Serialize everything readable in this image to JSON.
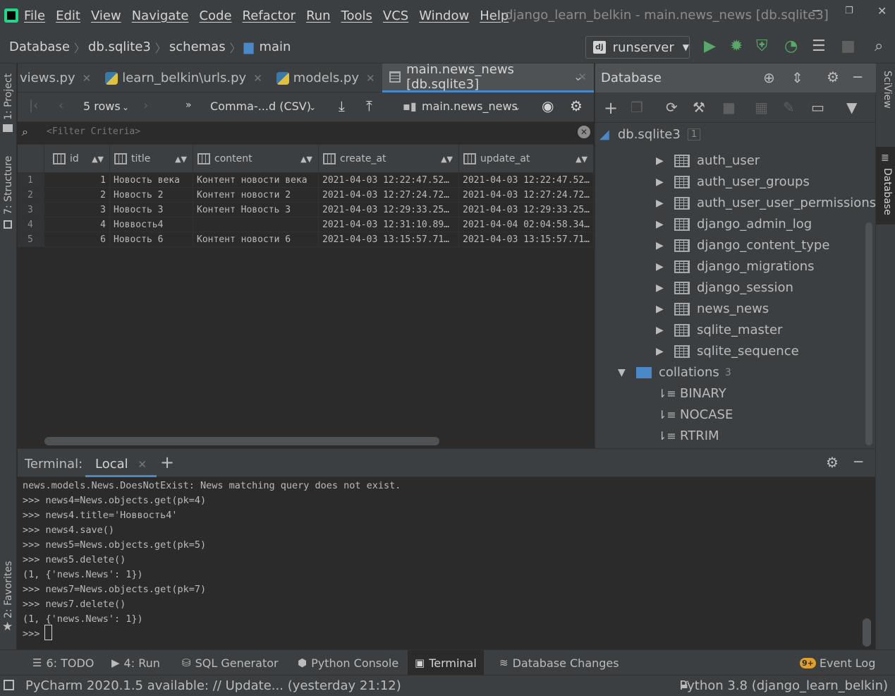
{
  "menu": {
    "items": [
      "File",
      "Edit",
      "View",
      "Navigate",
      "Code",
      "Refactor",
      "Run",
      "Tools",
      "VCS",
      "Window",
      "Help"
    ],
    "window_title": "django_learn_belkin - main.news_news [db.sqlite3]"
  },
  "navbar": {
    "breadcrumbs": [
      "Database",
      "db.sqlite3",
      "schemas",
      "main"
    ],
    "run_config": "runserver"
  },
  "left_strip": {
    "project": "1: Project",
    "structure": "7: Structure",
    "favorites": "2: Favorites"
  },
  "right_strip": {
    "sciview": "SciView",
    "database": "Database"
  },
  "tabs": [
    {
      "label": "views.py"
    },
    {
      "label": "learn_belkin\\urls.py"
    },
    {
      "label": "models.py"
    },
    {
      "label": "main.news_news [db.sqlite3]"
    }
  ],
  "grid_toolbar": {
    "rows": "5 rows",
    "extractor": "Comma-...d (CSV)",
    "table": "main.news_news"
  },
  "filter": {
    "placeholder": "<Filter Criteria>"
  },
  "grid": {
    "columns": [
      "id",
      "title",
      "content",
      "create_at",
      "update_at"
    ],
    "rows": [
      {
        "n": "1",
        "id": "1",
        "title": "Новость века",
        "content": "Контент новости века",
        "create_at": "2021-04-03 12:22:47.52…",
        "update_at": "2021-04-03 12:22:47.52…"
      },
      {
        "n": "2",
        "id": "2",
        "title": "Новость 2",
        "content": "Контент новости 2",
        "create_at": "2021-04-03 12:27:24.72…",
        "update_at": "2021-04-03 12:27:24.72…"
      },
      {
        "n": "3",
        "id": "3",
        "title": "Новость 3",
        "content": "Контент Новость 3",
        "create_at": "2021-04-03 12:29:33.25…",
        "update_at": "2021-04-03 12:29:33.25…"
      },
      {
        "n": "4",
        "id": "4",
        "title": "Нoввость4",
        "content": "",
        "create_at": "2021-04-03 12:31:10.89…",
        "update_at": "2021-04-04 02:04:58.34…"
      },
      {
        "n": "5",
        "id": "6",
        "title": "Новость 6",
        "content": "Контент новости 6",
        "create_at": "2021-04-03 13:15:57.71…",
        "update_at": "2021-04-03 13:15:57.71…"
      }
    ]
  },
  "db_panel": {
    "title": "Database",
    "root": "db.sqlite3",
    "root_count": "1",
    "tables": [
      "auth_user",
      "auth_user_groups",
      "auth_user_user_permissions",
      "django_admin_log",
      "django_content_type",
      "django_migrations",
      "django_session",
      "news_news",
      "sqlite_master",
      "sqlite_sequence"
    ],
    "collations_label": "collations",
    "collations_count": "3",
    "collations": [
      "BINARY",
      "NOCASE",
      "RTRIM"
    ]
  },
  "terminal": {
    "label": "Terminal:",
    "tab": "Local",
    "lines": [
      "news.models.News.DoesNotExist: News matching query does not exist.",
      ">>> news4=News.objects.get(pk=4)",
      ">>> news4.title='Нoввость4'",
      ">>> news4.save()",
      ">>> news5=News.objects.get(pk=5)",
      ">>> news5.delete()",
      "(1, {'news.News': 1})",
      ">>> news7=News.objects.get(pk=7)",
      ">>> news7.delete()",
      "(1, {'news.News': 1})",
      ">>> "
    ]
  },
  "bottom_tools": {
    "todo": "6: TODO",
    "run": "4: Run",
    "sql": "SQL Generator",
    "pyconsole": "Python Console",
    "terminal": "Terminal",
    "dbchanges": "Database Changes",
    "eventlog": "Event Log",
    "eventlog_badge": "9+"
  },
  "status": {
    "message": "PyCharm 2020.1.5 available: // Update... (yesterday 21:12)",
    "interpreter": "Python 3.8 (django_learn_belkin)"
  },
  "colors": {
    "accent": "#4a88c7",
    "run": "#59a869",
    "bg": "#2b2b2b",
    "panel": "#3c3f41"
  }
}
